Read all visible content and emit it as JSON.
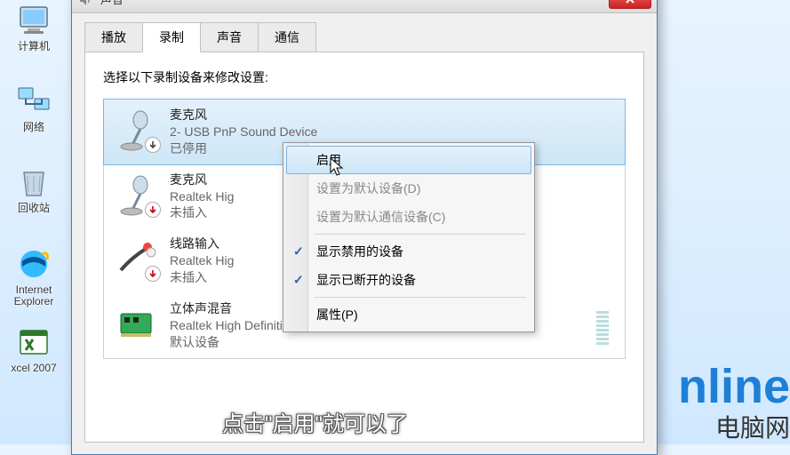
{
  "desktop": {
    "icons": [
      {
        "label": "计算机"
      },
      {
        "label": "网络"
      },
      {
        "label": "回收站"
      },
      {
        "label": "Internet Explorer"
      },
      {
        "label": "xcel 2007"
      }
    ]
  },
  "window": {
    "title": "声音",
    "tabs": [
      {
        "label": "播放"
      },
      {
        "label": "录制"
      },
      {
        "label": "声音"
      },
      {
        "label": "通信"
      }
    ],
    "active_tab": 1,
    "instruction": "选择以下录制设备来修改设置:",
    "devices": [
      {
        "name": "麦克风",
        "desc": "2- USB PnP Sound Device",
        "status": "已停用"
      },
      {
        "name": "麦克风",
        "desc": "Realtek Hig",
        "status": "未插入"
      },
      {
        "name": "线路输入",
        "desc": "Realtek Hig",
        "status": "未插入"
      },
      {
        "name": "立体声混音",
        "desc": "Realtek High Definition Audio",
        "status": "默认设备"
      }
    ]
  },
  "context_menu": {
    "items": [
      {
        "label": "启用"
      },
      {
        "label": "设置为默认设备(D)"
      },
      {
        "label": "设置为默认通信设备(C)"
      },
      {
        "label": "显示禁用的设备"
      },
      {
        "label": "显示已断开的设备"
      },
      {
        "label": "属性(P)"
      }
    ]
  },
  "subtitle": "点击\"启用\"就可以了",
  "watermark": {
    "logo": "nline",
    "sub": "电脑网"
  }
}
